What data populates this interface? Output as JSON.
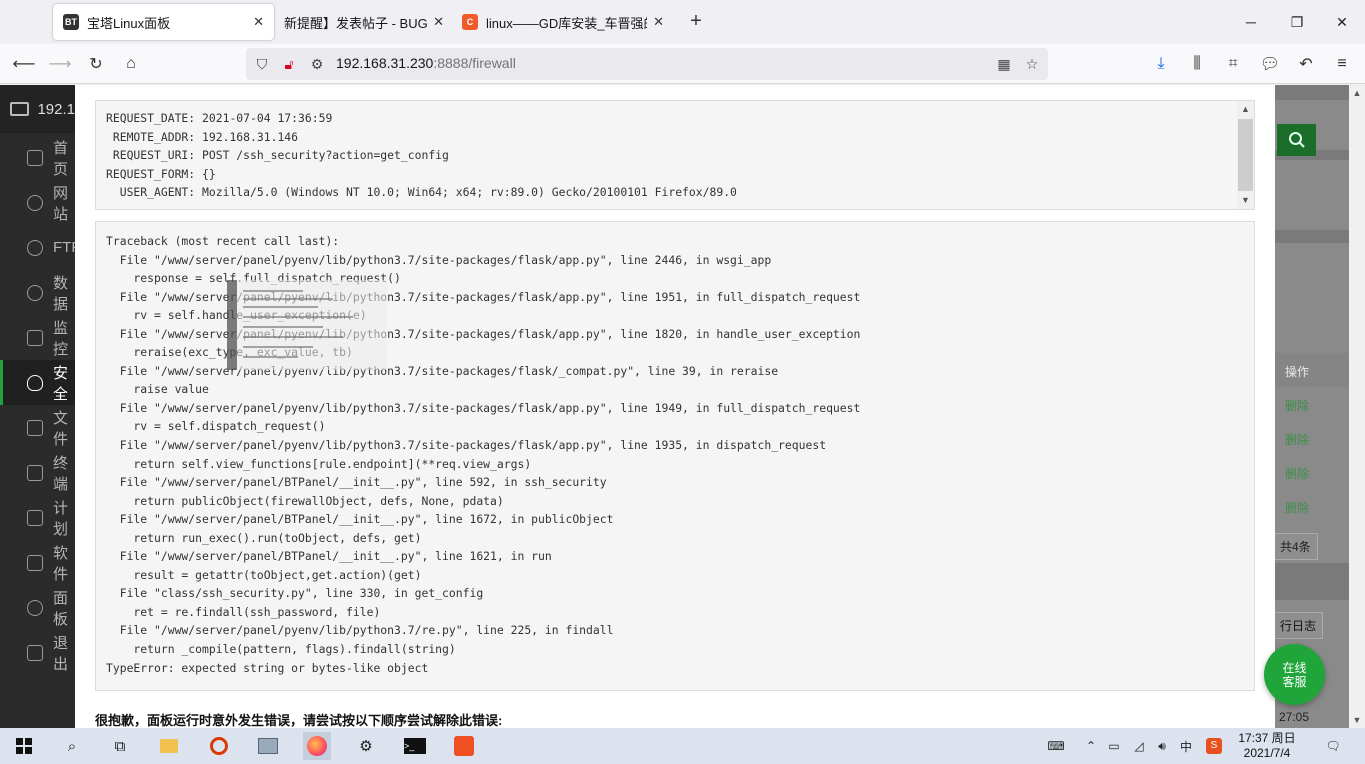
{
  "browser": {
    "tabs": [
      {
        "title": "宝塔Linux面板",
        "favicon": "BT",
        "favicon_color": "#333333",
        "active": true
      },
      {
        "title": "新提醒】发表帖子 - BUG提交",
        "favicon": "",
        "favicon_color": "",
        "active": false
      },
      {
        "title": "linux——GD库安装_车晋强的",
        "favicon": "C",
        "favicon_color": "#f25a29",
        "active": false
      }
    ],
    "new_tab": "+",
    "url_host": "192.168.31.230",
    "url_rest": ":8888/firewall"
  },
  "sidebar": {
    "header": "192.1",
    "items": [
      "首页",
      "网站",
      "FTP",
      "数据",
      "监控",
      "安全",
      "文件",
      "终端",
      "计划",
      "软件",
      "面板",
      "退出"
    ]
  },
  "right_panel": {
    "col_header": "操作",
    "delete_label": "删除",
    "total": "共4条",
    "log_button": "行日志",
    "time_fragment": "27:05"
  },
  "error": {
    "request_lines": [
      "REQUEST_DATE: 2021-07-04 17:36:59",
      " REMOTE_ADDR: 192.168.31.146",
      " REQUEST_URI: POST /ssh_security?action=get_config",
      "REQUEST_FORM: {}",
      "  USER_AGENT: Mozilla/5.0 (Windows NT 10.0; Win64; x64; rv:89.0) Gecko/20100101 Firefox/89.0"
    ],
    "traceback_lines": [
      "Traceback (most recent call last):",
      "  File \"/www/server/panel/pyenv/lib/python3.7/site-packages/flask/app.py\", line 2446, in wsgi_app",
      "    response = self.full_dispatch_request()",
      "  File \"/www/server/panel/pyenv/lib/python3.7/site-packages/flask/app.py\", line 1951, in full_dispatch_request",
      "    rv = self.handle_user_exception(e)",
      "  File \"/www/server/panel/pyenv/lib/python3.7/site-packages/flask/app.py\", line 1820, in handle_user_exception",
      "    reraise(exc_type, exc_value, tb)",
      "  File \"/www/server/panel/pyenv/lib/python3.7/site-packages/flask/_compat.py\", line 39, in reraise",
      "    raise value",
      "  File \"/www/server/panel/pyenv/lib/python3.7/site-packages/flask/app.py\", line 1949, in full_dispatch_request",
      "    rv = self.dispatch_request()",
      "  File \"/www/server/panel/pyenv/lib/python3.7/site-packages/flask/app.py\", line 1935, in dispatch_request",
      "    return self.view_functions[rule.endpoint](**req.view_args)",
      "  File \"/www/server/panel/BTPanel/__init__.py\", line 592, in ssh_security",
      "    return publicObject(firewallObject, defs, None, pdata)",
      "  File \"/www/server/panel/BTPanel/__init__.py\", line 1672, in publicObject",
      "    return run_exec().run(toObject, defs, get)",
      "  File \"/www/server/panel/BTPanel/__init__.py\", line 1621, in run",
      "    result = getattr(toObject,get.action)(get)",
      "  File \"class/ssh_security.py\", line 330, in get_config",
      "    ret = re.findall(ssh_password, file)",
      "  File \"/www/server/panel/pyenv/lib/python3.7/re.py\", line 225, in findall",
      "    return _compile(pattern, flags).findall(string)",
      "TypeError: expected string or bytes-like object"
    ],
    "sorry_message": "很抱歉，面板运行时意外发生错误，请尝试按以下顺序尝试解除此错误:"
  },
  "support_button": [
    "在线",
    "客服"
  ],
  "taskbar": {
    "time": "17:37 周日",
    "date": "2021/7/4",
    "ime": "中"
  },
  "colors": {
    "brand_green": "#20a53a",
    "sidebar_bg": "#2b2b2b"
  }
}
